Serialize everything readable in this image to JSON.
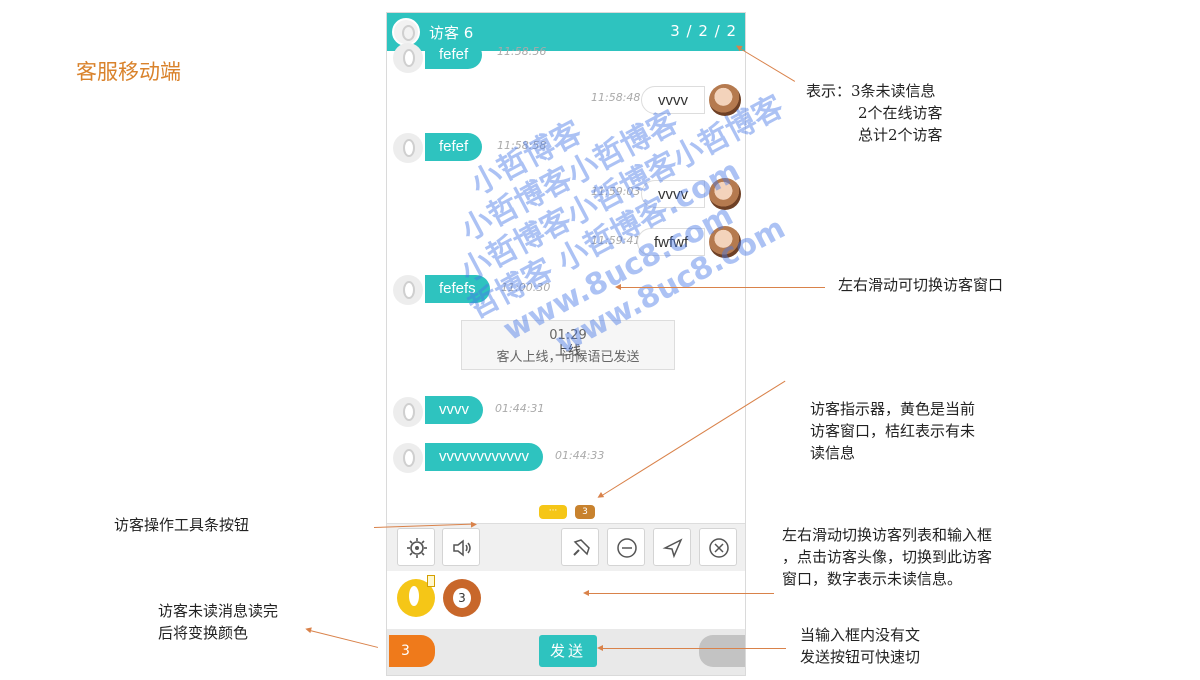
{
  "page_title": "客服移动端",
  "phone": {
    "header": {
      "title": "访客 6",
      "counts": "3 / 2 / 2"
    },
    "messages": [
      {
        "type": "in",
        "text": "fefef",
        "time": "11:58:56"
      },
      {
        "type": "out",
        "text": "vvvv",
        "time": "11:58:48"
      },
      {
        "type": "in",
        "text": "fefef",
        "time": "11:58:58"
      },
      {
        "type": "out",
        "text": "vvvv",
        "time": "11:59:03"
      },
      {
        "type": "out",
        "text": "fwfwf",
        "time": "11:59:41"
      },
      {
        "type": "in",
        "text": "fefefs",
        "time": "11:00:30"
      },
      {
        "type": "in",
        "text": "vvvv",
        "time": "01:44:31"
      },
      {
        "type": "in",
        "text": "vvvvvvvvvvvv",
        "time": "01:44:33"
      }
    ],
    "system_box": {
      "line1": "01:29",
      "line2": "上线",
      "line3": "客人上线，问候语已发送"
    },
    "indicators": {
      "yellow": "···",
      "orange": "3"
    },
    "toolbar_icons": [
      "settings-icon",
      "speaker-icon",
      "flashlight-icon",
      "minus-circle-icon",
      "send-arrow-icon",
      "close-circle-icon"
    ],
    "visitor_list": {
      "unread_count": "3"
    },
    "bottom_bar": {
      "unread_count": "3",
      "send_label": "发送"
    }
  },
  "watermark": {
    "lines": [
      "小哲博客",
      "小哲博客小哲博客",
      "小哲博客小哲博客小哲博客",
      "哲博客 小哲博客.com",
      "www.8uc8.com",
      "www.8uc8.com"
    ]
  },
  "annotations": {
    "counts_note": [
      "表示：3条未读信息",
      "2个在线访客",
      "总计2个访客"
    ],
    "swipe_note": "左右滑动可切换访客窗口",
    "indicator_note": [
      "访客指示器，黄色是当前",
      "访客窗口，桔红表示有未",
      "读信息"
    ],
    "toolbar_note": "访客操作工具条按钮",
    "list_note": [
      "左右滑动切换访客列表和输入框",
      "，点击访客头像，切换到此访客",
      "窗口，数字表示未读信息。"
    ],
    "unread_note": [
      "访客未读消息读完",
      "后将变换颜色"
    ],
    "send_note": [
      "当输入框内没有文",
      "发送按钮可快速切"
    ]
  }
}
